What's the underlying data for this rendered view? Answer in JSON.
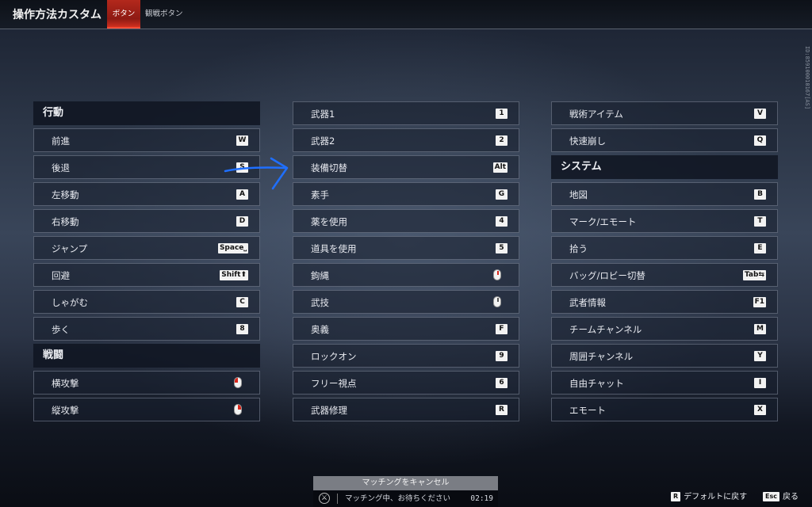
{
  "header": {
    "title": "操作方法カスタム",
    "tabs": [
      {
        "label": "ボタン",
        "active": true
      },
      {
        "label": "観戦ボタン",
        "active": false
      }
    ]
  },
  "version_id": "ID:8591000101​67[AS]",
  "columns": {
    "col1": {
      "sections": [
        {
          "title": "行動",
          "items": [
            {
              "label": "前進",
              "key": "W"
            },
            {
              "label": "後退",
              "key": "S"
            },
            {
              "label": "左移動",
              "key": "A"
            },
            {
              "label": "右移動",
              "key": "D"
            },
            {
              "label": "ジャンプ",
              "key": "Space⎵"
            },
            {
              "label": "回避",
              "key": "Shift⬆"
            },
            {
              "label": "しゃがむ",
              "key": "C"
            },
            {
              "label": "歩く",
              "key": "8"
            }
          ]
        },
        {
          "title": "戦闘",
          "items": [
            {
              "label": "横攻撃",
              "key": "mouse-left-icon"
            },
            {
              "label": "縦攻撃",
              "key": "mouse-right-icon"
            }
          ]
        }
      ]
    },
    "col2": {
      "items": [
        {
          "label": "武器1",
          "key": "1"
        },
        {
          "label": "武器2",
          "key": "2"
        },
        {
          "label": "装備切替",
          "key": "Alt"
        },
        {
          "label": "素手",
          "key": "G"
        },
        {
          "label": "薬を使用",
          "key": "4"
        },
        {
          "label": "道具を使用",
          "key": "5"
        },
        {
          "label": "鉤縄",
          "key": "mouse-wheel-icon"
        },
        {
          "label": "武技",
          "key": "mouse-wheel-icon"
        },
        {
          "label": "奥義",
          "key": "F"
        },
        {
          "label": "ロックオン",
          "key": "9"
        },
        {
          "label": "フリー視点",
          "key": "6"
        },
        {
          "label": "武器修理",
          "key": "R"
        }
      ]
    },
    "col3": {
      "items_top": [
        {
          "label": "戦術アイテム",
          "key": "V"
        },
        {
          "label": "快速崩し",
          "key": "Q"
        }
      ],
      "section_title": "システム",
      "items_system": [
        {
          "label": "地図",
          "key": "B"
        },
        {
          "label": "マーク/エモート",
          "key": "T"
        },
        {
          "label": "拾う",
          "key": "E"
        },
        {
          "label": "バッグ/ロビー切替",
          "key": "Tab⇆"
        },
        {
          "label": "武者情報",
          "key": "F1"
        },
        {
          "label": "チームチャンネル",
          "key": "M"
        },
        {
          "label": "周囲チャンネル",
          "key": "Y"
        },
        {
          "label": "自由チャット",
          "key": "I"
        },
        {
          "label": "エモート",
          "key": "X"
        }
      ]
    }
  },
  "matching": {
    "cancel_label": "マッチングをキャンセル",
    "status_text": "マッチング中、お待ちください",
    "timer": "02:19"
  },
  "footer": {
    "default_key": "R",
    "default_label": "デフォルトに戻す",
    "back_key": "Esc",
    "back_label": "戻る"
  },
  "colors": {
    "accent": "#b3281c",
    "annotation": "#1f6fff"
  }
}
